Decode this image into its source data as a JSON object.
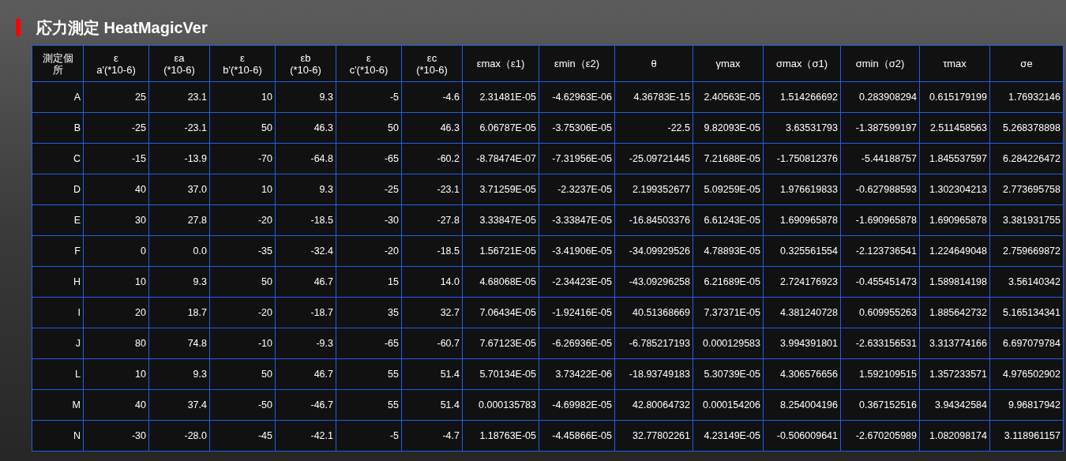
{
  "title": "応力測定 HeatMagicVer",
  "table": {
    "columns": [
      "測定個所",
      "ε\na'(*10-6)",
      "εa\n(*10-6)",
      "ε\nb'(*10-6)",
      "εb\n(*10-6)",
      "ε\nc'(*10-6)",
      "εc\n(*10-6)",
      "εmax（ε1)",
      "εmin（ε2)",
      "θ",
      "γmax",
      "σmax（σ1)",
      "σmin（σ2)",
      "τmax",
      "σe"
    ],
    "rows": [
      [
        "A",
        "25",
        "23.1",
        "10",
        "9.3",
        "-5",
        "-4.6",
        "2.31481E-05",
        "-4.62963E-06",
        "4.36783E-15",
        "2.40563E-05",
        "1.514266692",
        "0.283908294",
        "0.615179199",
        "1.76932146"
      ],
      [
        "B",
        "-25",
        "-23.1",
        "50",
        "46.3",
        "50",
        "46.3",
        "6.06787E-05",
        "-3.75306E-05",
        "-22.5",
        "9.82093E-05",
        "3.63531793",
        "-1.387599197",
        "2.511458563",
        "5.268378898"
      ],
      [
        "C",
        "-15",
        "-13.9",
        "-70",
        "-64.8",
        "-65",
        "-60.2",
        "-8.78474E-07",
        "-7.31956E-05",
        "-25.09721445",
        "7.21688E-05",
        "-1.750812376",
        "-5.44188757",
        "1.845537597",
        "6.284226472"
      ],
      [
        "D",
        "40",
        "37.0",
        "10",
        "9.3",
        "-25",
        "-23.1",
        "3.71259E-05",
        "-2.3237E-05",
        "2.199352677",
        "5.09259E-05",
        "1.976619833",
        "-0.627988593",
        "1.302304213",
        "2.773695758"
      ],
      [
        "E",
        "30",
        "27.8",
        "-20",
        "-18.5",
        "-30",
        "-27.8",
        "3.33847E-05",
        "-3.33847E-05",
        "-16.84503376",
        "6.61243E-05",
        "1.690965878",
        "-1.690965878",
        "1.690965878",
        "3.381931755"
      ],
      [
        "F",
        "0",
        "0.0",
        "-35",
        "-32.4",
        "-20",
        "-18.5",
        "1.56721E-05",
        "-3.41906E-05",
        "-34.09929526",
        "4.78893E-05",
        "0.325561554",
        "-2.123736541",
        "1.224649048",
        "2.759669872"
      ],
      [
        "H",
        "10",
        "9.3",
        "50",
        "46.7",
        "15",
        "14.0",
        "4.68068E-05",
        "-2.34423E-05",
        "-43.09296258",
        "6.21689E-05",
        "2.724176923",
        "-0.455451473",
        "1.589814198",
        "3.56140342"
      ],
      [
        "I",
        "20",
        "18.7",
        "-20",
        "-18.7",
        "35",
        "32.7",
        "7.06434E-05",
        "-1.92416E-05",
        "40.51368669",
        "7.37371E-05",
        "4.381240728",
        "0.609955263",
        "1.885642732",
        "5.165134341"
      ],
      [
        "J",
        "80",
        "74.8",
        "-10",
        "-9.3",
        "-65",
        "-60.7",
        "7.67123E-05",
        "-6.26936E-05",
        "-6.785217193",
        "0.000129583",
        "3.994391801",
        "-2.633156531",
        "3.313774166",
        "6.697079784"
      ],
      [
        "L",
        "10",
        "9.3",
        "50",
        "46.7",
        "55",
        "51.4",
        "5.70134E-05",
        "3.73422E-06",
        "-18.93749183",
        "5.30739E-05",
        "4.306576656",
        "1.592109515",
        "1.357233571",
        "4.976502902"
      ],
      [
        "M",
        "40",
        "37.4",
        "-50",
        "-46.7",
        "55",
        "51.4",
        "0.000135783",
        "-4.69982E-05",
        "42.80064732",
        "0.000154206",
        "8.254004196",
        "0.367152516",
        "3.94342584",
        "9.96817942"
      ],
      [
        "N",
        "-30",
        "-28.0",
        "-45",
        "-42.1",
        "-5",
        "-4.7",
        "1.18763E-05",
        "-4.45866E-05",
        "32.77802261",
        "4.23149E-05",
        "-0.506009641",
        "-2.670205989",
        "1.082098174",
        "3.118961157"
      ]
    ]
  }
}
